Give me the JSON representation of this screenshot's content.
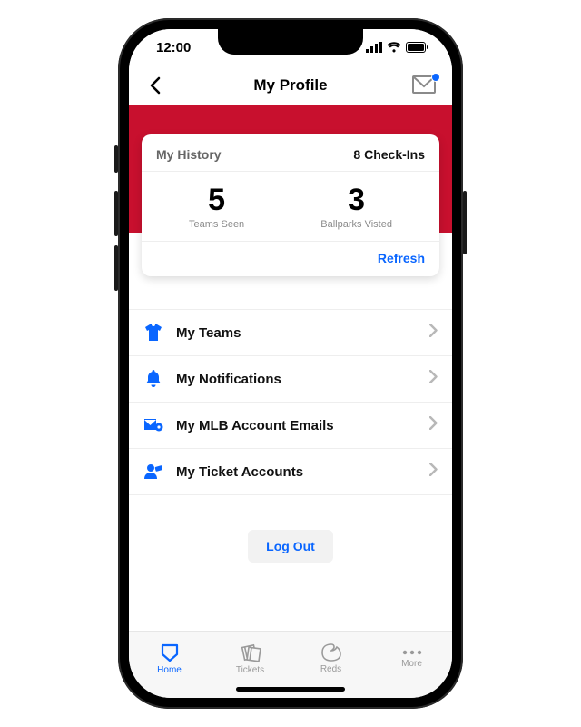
{
  "status": {
    "time": "12:00"
  },
  "header": {
    "title": "My Profile"
  },
  "history": {
    "card_title": "My History",
    "checkins_count": 8,
    "checkins_label": "Check-Ins",
    "teams_seen": 5,
    "teams_seen_label": "Teams Seen",
    "ballparks": 3,
    "ballparks_label": "Ballparks Visted",
    "refresh": "Refresh"
  },
  "menu": [
    {
      "label": "My Teams"
    },
    {
      "label": "My Notifications"
    },
    {
      "label": "My MLB Account Emails"
    },
    {
      "label": "My Ticket Accounts"
    }
  ],
  "logout": "Log Out",
  "tabs": [
    {
      "label": "Home",
      "active": true
    },
    {
      "label": "Tickets",
      "active": false
    },
    {
      "label": "Reds",
      "active": false
    },
    {
      "label": "More",
      "active": false
    }
  ]
}
